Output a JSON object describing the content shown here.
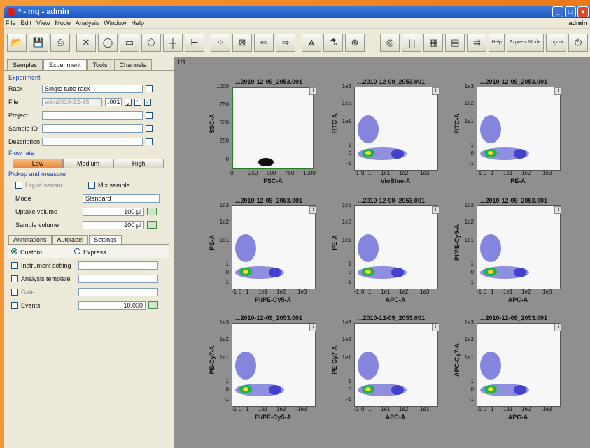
{
  "window": {
    "title": "* - mq - admin",
    "user": "admin"
  },
  "menu": [
    "File",
    "Edit",
    "View",
    "Mode",
    "Analysis",
    "Window",
    "Help"
  ],
  "toolbar": {
    "help_label": "Help",
    "express_label": "Express Mode",
    "logout_label": "Logout"
  },
  "tabs": [
    "Samples",
    "Experiment",
    "Tools",
    "Channels"
  ],
  "experiment": {
    "section_title": "Experiment",
    "rack_label": "Rack",
    "rack_value": "Single tube rack",
    "file_label": "File",
    "file_value": "adm2010-12-15",
    "file_suffix": ".001",
    "project_label": "Project",
    "sample_id_label": "Sample ID",
    "description_label": "Description"
  },
  "flow_rate": {
    "section_title": "Flow rate",
    "options": [
      "Low",
      "Medium",
      "High"
    ],
    "selected": "Low"
  },
  "pickup": {
    "section_title": "Pickup and measure",
    "liquid_sensor": "Liquid sensor",
    "mix_sample": "Mix sample",
    "mode_label": "Mode",
    "mode_value": "Standard",
    "uptake_label": "Uptake volume",
    "uptake_value": "100 µl",
    "sample_label": "Sample volume",
    "sample_value": "200 µl"
  },
  "subtabs": [
    "Annotations",
    "Autolabel",
    "Settings"
  ],
  "settings": {
    "custom": "Custom",
    "express": "Express",
    "instrument": "Instrument setting",
    "analysis": "Analysis template",
    "gate": "Gate",
    "events": "Events",
    "events_value": "10.000"
  },
  "page_indicator": "1/1",
  "plot_title": "...2010-12-09_2053.001",
  "plots": [
    {
      "x": "FSC-A",
      "y": "SSC-A",
      "linear": true
    },
    {
      "x": "VioBlue-A",
      "y": "FITC-A"
    },
    {
      "x": "PE-A",
      "y": "FITC-A"
    },
    {
      "x": "PI/PE-Cy5-A",
      "y": "PE-A"
    },
    {
      "x": "APC-A",
      "y": "PE-A"
    },
    {
      "x": "APC-A",
      "y": "PI/PE-Cy5-A"
    },
    {
      "x": "PI/PE-Cy5-A",
      "y": "PE-Cy7-A"
    },
    {
      "x": "APC-A",
      "y": "PE-Cy7-A"
    },
    {
      "x": "APC-A",
      "y": "APC-Cy7-A"
    }
  ],
  "lin_ticks_x": [
    "0",
    "250",
    "500",
    "750",
    "1000"
  ],
  "lin_ticks_y": [
    "1000",
    "750",
    "500",
    "250",
    "0"
  ],
  "log_ticks_x": [
    "-1",
    "0",
    "1",
    "1e1",
    "1e2",
    "1e3"
  ],
  "log_ticks_y": [
    "1e3",
    "1e2",
    "1e1",
    "1",
    "0",
    "-1"
  ]
}
